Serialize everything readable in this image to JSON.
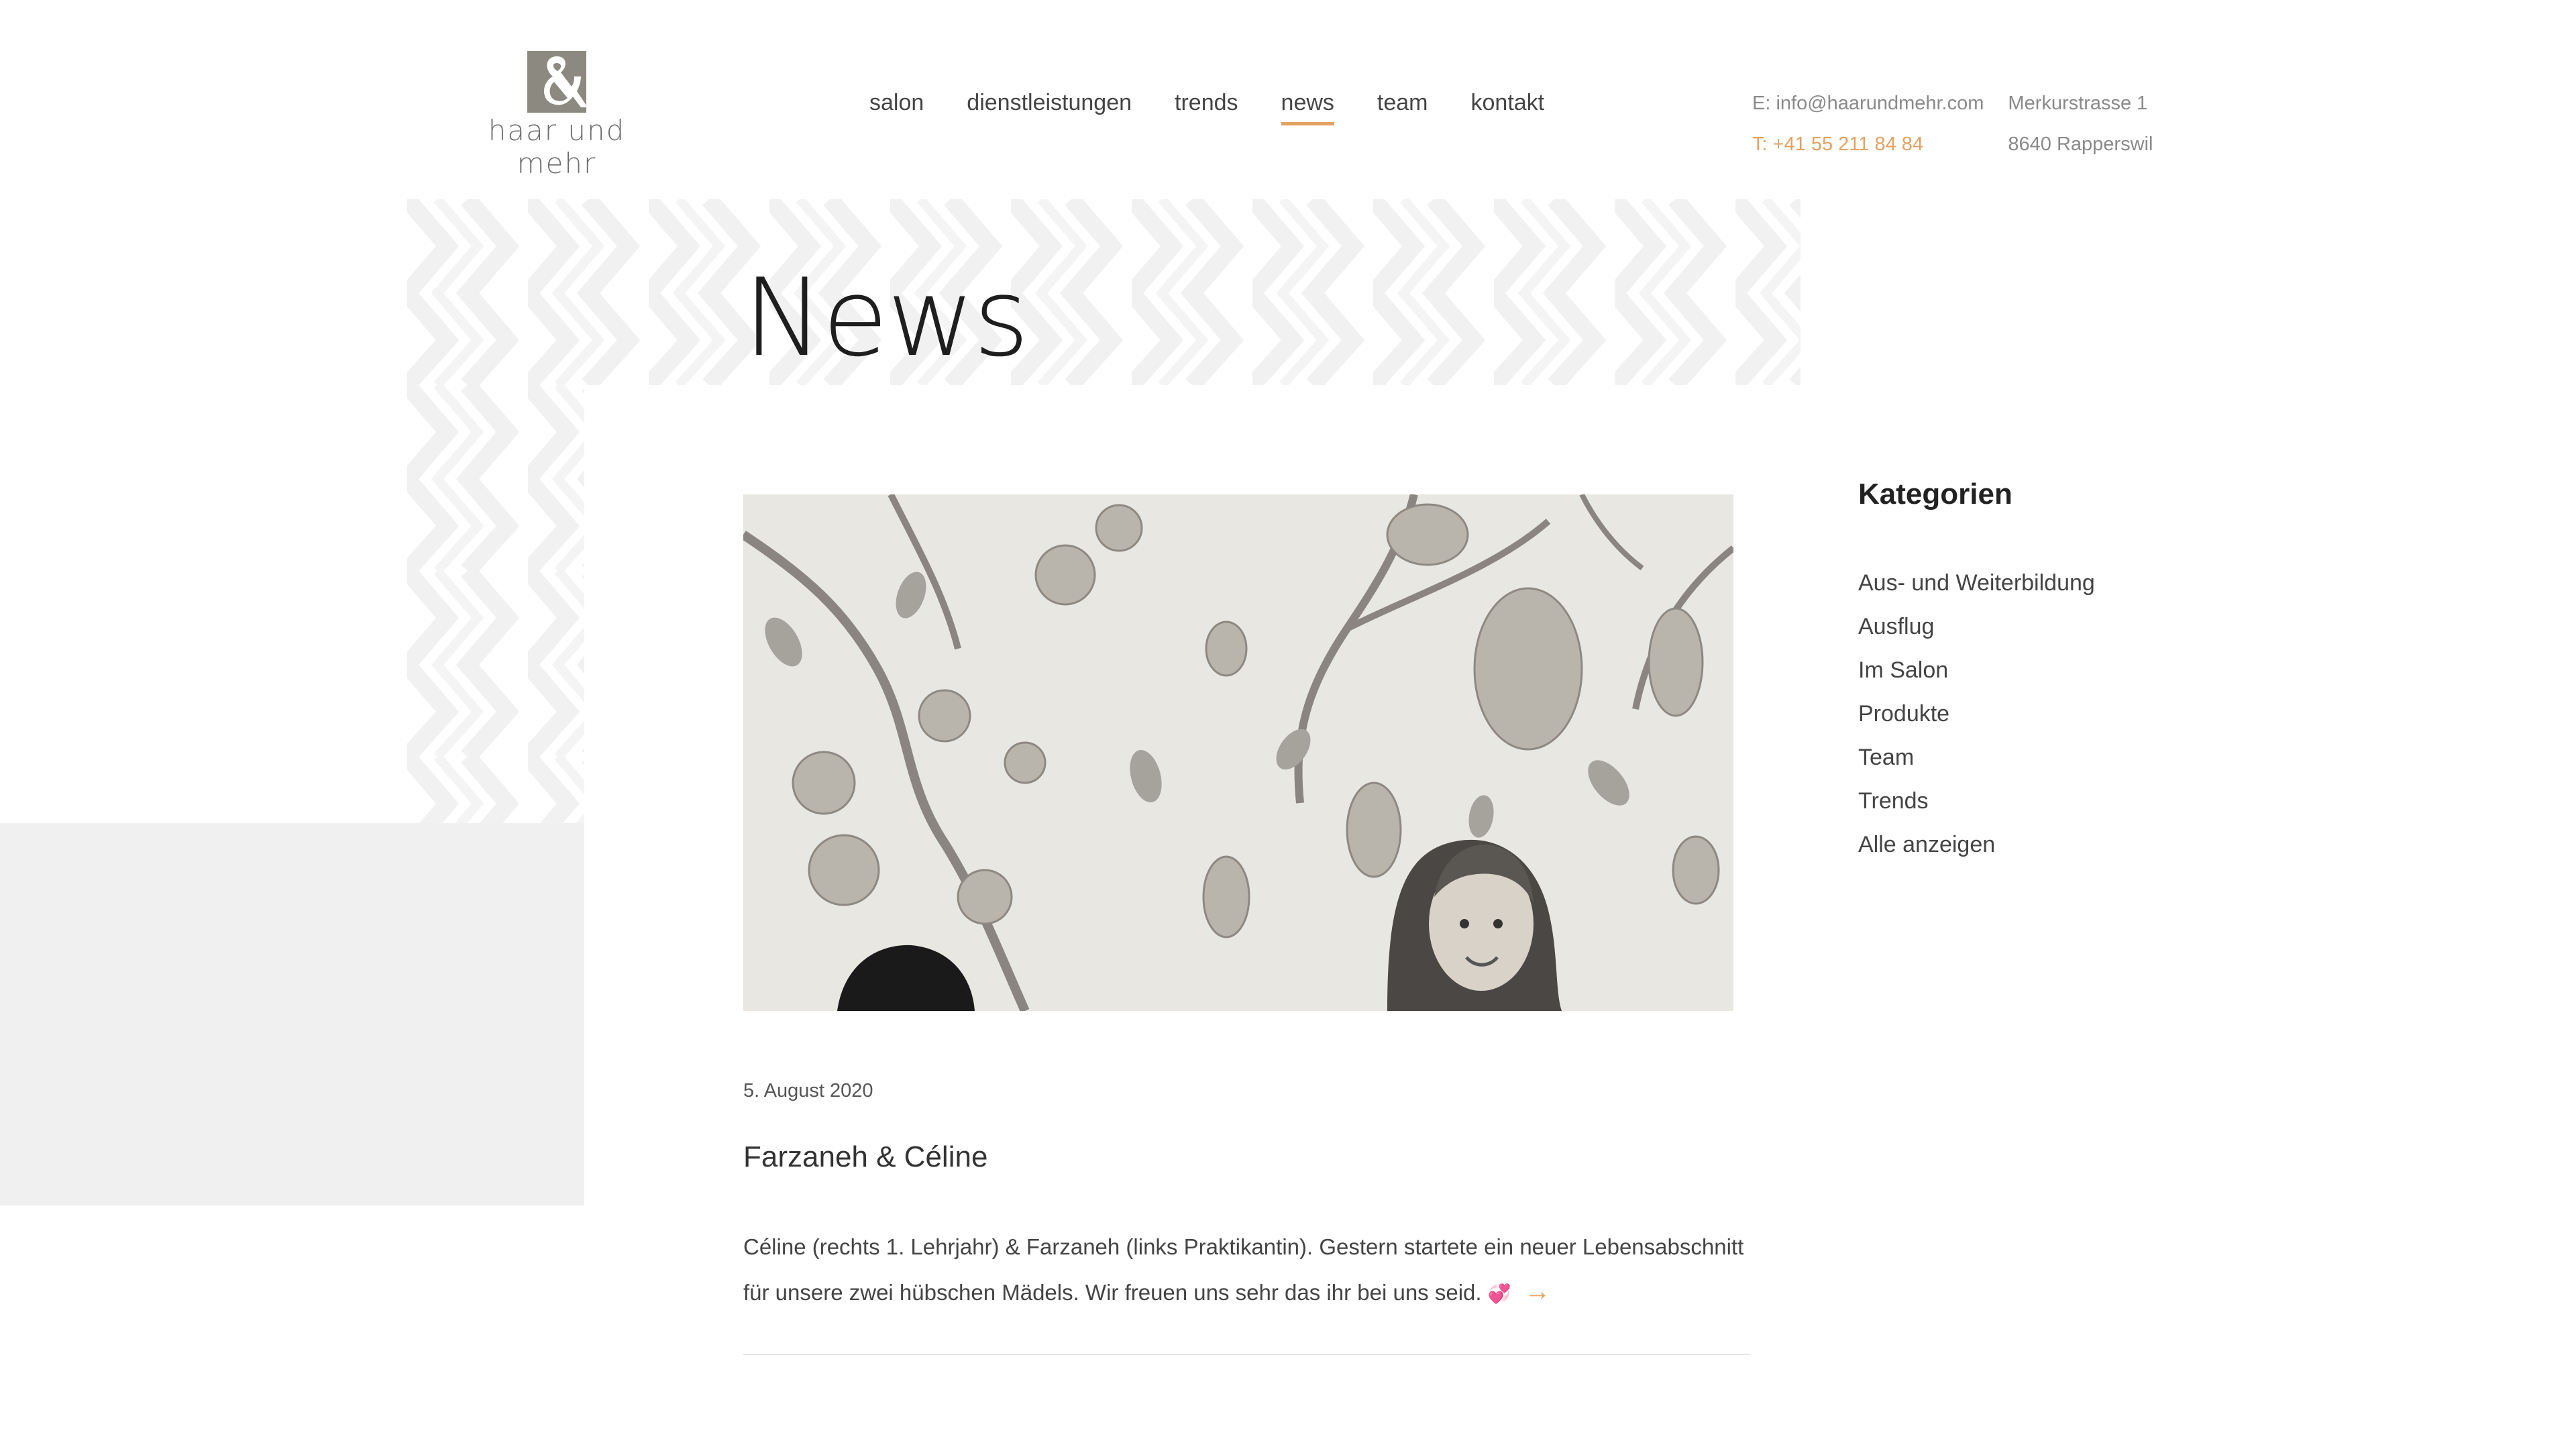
{
  "logo": {
    "text": "haar und mehr",
    "mark": "&"
  },
  "nav": {
    "items": [
      {
        "label": "salon"
      },
      {
        "label": "dienstleistungen"
      },
      {
        "label": "trends"
      },
      {
        "label": "news",
        "active": true
      },
      {
        "label": "team"
      },
      {
        "label": "kontakt"
      }
    ]
  },
  "contact": {
    "email": "E: info@haarundmehr.com",
    "phone": "T: +41 55 211 84 84",
    "street": "Merkurstrasse 1",
    "city": "8640 Rapperswil"
  },
  "page": {
    "title": "News"
  },
  "post": {
    "date": "5. August 2020",
    "title": "Farzaneh & Céline",
    "excerpt": "Céline (rechts 1. Lehrjahr) & Farzaneh (links Praktikantin). Gestern startete ein neuer Lebensabschnitt für unsere zwei hübschen Mädels. Wir freuen uns sehr das ihr bei uns seid.",
    "emoji": "💞",
    "read_more": "→"
  },
  "sidebar": {
    "title": "Kategorien",
    "items": [
      {
        "label": "Aus- und Weiterbildung"
      },
      {
        "label": "Ausflug"
      },
      {
        "label": "Im Salon"
      },
      {
        "label": "Produkte"
      },
      {
        "label": "Team"
      },
      {
        "label": "Trends"
      },
      {
        "label": "Alle anzeigen"
      }
    ]
  },
  "colors": {
    "accent": "#e3a162",
    "logo_grey": "#8c8a80",
    "pattern": "#f2f2f2",
    "grey_block": "#f0f0f0"
  }
}
